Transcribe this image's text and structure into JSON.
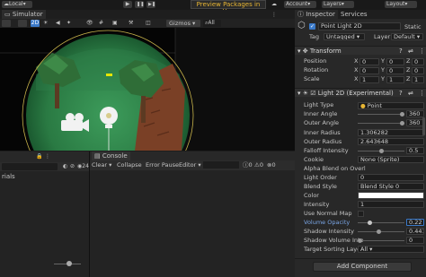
{
  "toolbar": {
    "local_label": "Local",
    "preview_label": "Preview Packages in Use",
    "account_label": "Account",
    "layers_label": "Layers",
    "layout_label": "Layout"
  },
  "simulator": {
    "tab_label": "Simulator",
    "mode_label": "2D",
    "gizmos_label": "Gizmos",
    "all_label": "All"
  },
  "bottom": {
    "console_tab": "Console",
    "clear_label": "Clear",
    "collapse_label": "Collapse",
    "error_pause_label": "Error Pause",
    "editor_label": "Editor",
    "left_count": "24",
    "log_count": "0",
    "warn_count": "0",
    "error_count": "0",
    "partial_text": "rials"
  },
  "inspector": {
    "tab_inspector": "Inspector",
    "tab_services": "Services",
    "object_name": "Point Light 2D",
    "static_label": "Static",
    "tag_label": "Tag",
    "tag_value": "Untagged",
    "layer_label": "Layer",
    "layer_value": "Default",
    "transform": {
      "title": "Transform",
      "position_label": "Position",
      "rotation_label": "Rotation",
      "scale_label": "Scale",
      "position": [
        "0",
        "0",
        "0"
      ],
      "rotation": [
        "0",
        "0",
        "0"
      ],
      "scale": [
        "1",
        "1",
        "1"
      ]
    },
    "light": {
      "title": "Light 2D (Experimental)",
      "rows": {
        "light_type": {
          "label": "Light Type",
          "value": "Point"
        },
        "inner_angle": {
          "label": "Inner Angle",
          "value": "360"
        },
        "outer_angle": {
          "label": "Outer Angle",
          "value": "360"
        },
        "inner_radius": {
          "label": "Inner Radius",
          "value": "1.306282"
        },
        "outer_radius": {
          "label": "Outer Radius",
          "value": "2.643648"
        },
        "falloff": {
          "label": "Falloff Intensity",
          "value": "0.5"
        },
        "cookie": {
          "label": "Cookie",
          "value": "None (Sprite)"
        },
        "alpha_blend": {
          "label": "Alpha Blend on Overl",
          "value": ""
        },
        "light_order": {
          "label": "Light Order",
          "value": "0"
        },
        "blend_style": {
          "label": "Blend Style",
          "value": "Blend Style 0"
        },
        "color": {
          "label": "Color",
          "value": ""
        },
        "intensity": {
          "label": "Intensity",
          "value": "1"
        },
        "normal_map": {
          "label": "Use Normal Map",
          "value": ""
        },
        "volume_opacity": {
          "label": "Volume Opacity",
          "value": "0.22"
        },
        "shadow_intensity": {
          "label": "Shadow Intensity",
          "value": "0.441"
        },
        "shadow_volume": {
          "label": "Shadow Volume Inte",
          "value": "0"
        },
        "target_layers": {
          "label": "Target Sorting Layer",
          "value": "All"
        }
      }
    },
    "add_component_label": "Add Component"
  },
  "colors": {
    "accent_blue": "#3a79c8",
    "preview_yellow": "#e8b634",
    "grass": "#2e7b45",
    "tree": "#2f6d37",
    "brick": "#8a4a2c"
  }
}
